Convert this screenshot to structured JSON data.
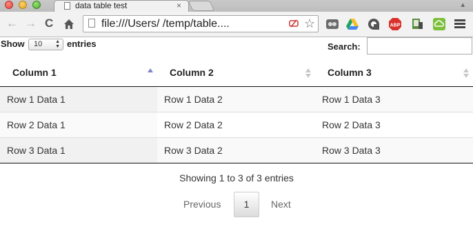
{
  "browser": {
    "tab_title": "data table test",
    "tab_close": "×",
    "url": "file:///Users/          /temp/table...."
  },
  "toolbar": {
    "back": "←",
    "forward": "→",
    "reload": "C",
    "star": "☆"
  },
  "extensions": [
    "evernote-icon",
    "drive-icon",
    "circle-icon",
    "adblock-icon",
    "pushbullet-icon",
    "cloud-icon"
  ],
  "controls": {
    "show_label": "Show",
    "length_value": "10",
    "entries_label": "entries",
    "search_label": "Search:",
    "search_value": ""
  },
  "table": {
    "headers": [
      "Column 1",
      "Column 2",
      "Column 3"
    ],
    "rows": [
      [
        "Row 1 Data 1",
        "Row 1 Data 2",
        "Row 1 Data 3"
      ],
      [
        "Row 2 Data 1",
        "Row 2 Data 2",
        "Row 2 Data 3"
      ],
      [
        "Row 3 Data 1",
        "Row 3 Data 2",
        "Row 3 Data 3"
      ]
    ]
  },
  "footer": {
    "info": "Showing 1 to 3 of 3 entries",
    "previous": "Previous",
    "page": "1",
    "next": "Next"
  },
  "colors": {
    "sort_active": "#7b86c9",
    "sort_inactive": "#c8c8c8"
  }
}
